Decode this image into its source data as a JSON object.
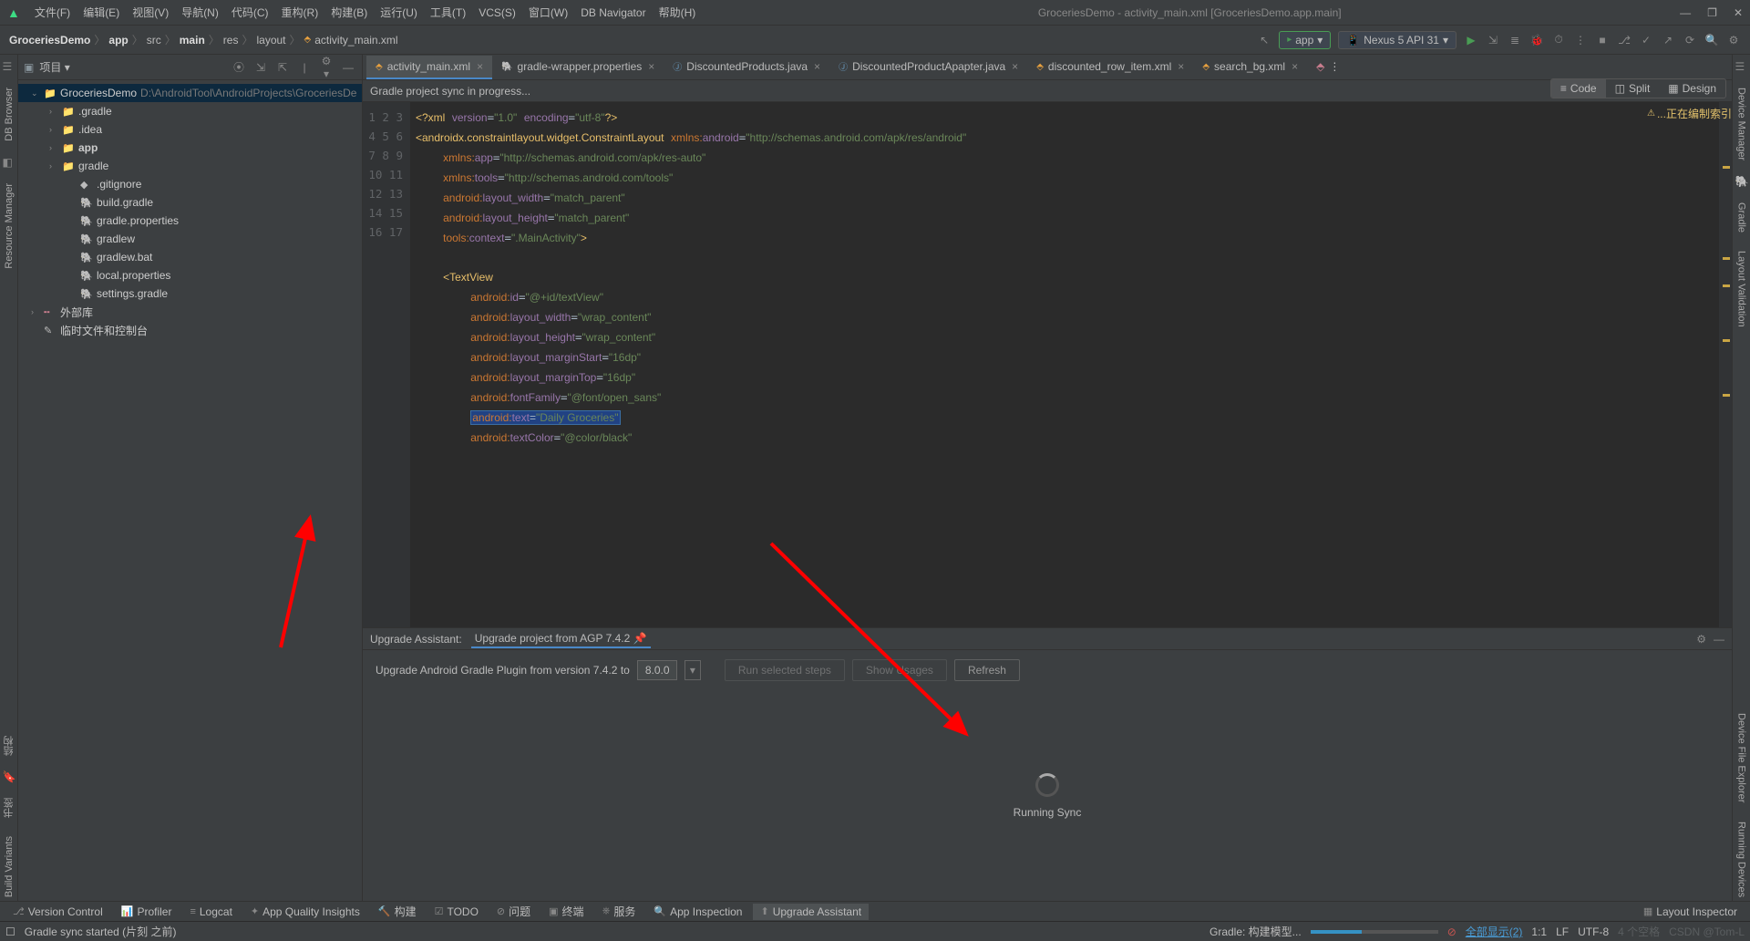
{
  "window_title": "GroceriesDemo - activity_main.xml [GroceriesDemo.app.main]",
  "menu": [
    "文件(F)",
    "编辑(E)",
    "视图(V)",
    "导航(N)",
    "代码(C)",
    "重构(R)",
    "构建(B)",
    "运行(U)",
    "工具(T)",
    "VCS(S)",
    "窗口(W)",
    "DB Navigator",
    "帮助(H)"
  ],
  "breadcrumb": [
    "GroceriesDemo",
    "app",
    "src",
    "main",
    "res",
    "layout",
    "activity_main.xml"
  ],
  "run_config": "app",
  "device": "Nexus 5 API 31",
  "project_tool_label": "项目",
  "tree": [
    {
      "depth": 0,
      "exp": true,
      "icon": "folder",
      "name": "GroceriesDemo",
      "path": "D:\\AndroidTool\\AndroidProjects\\GroceriesDe",
      "sel": true
    },
    {
      "depth": 1,
      "exp": false,
      "icon": "folder",
      "name": ".gradle"
    },
    {
      "depth": 1,
      "exp": false,
      "icon": "folder",
      "name": ".idea"
    },
    {
      "depth": 1,
      "exp": false,
      "icon": "folder",
      "name": "app",
      "bold": true
    },
    {
      "depth": 1,
      "exp": false,
      "icon": "folder",
      "name": "gradle"
    },
    {
      "depth": 2,
      "icon": "git",
      "name": ".gitignore"
    },
    {
      "depth": 2,
      "icon": "gradle",
      "name": "build.gradle"
    },
    {
      "depth": 2,
      "icon": "gradle",
      "name": "gradle.properties"
    },
    {
      "depth": 2,
      "icon": "gradle",
      "name": "gradlew"
    },
    {
      "depth": 2,
      "icon": "gradle",
      "name": "gradlew.bat"
    },
    {
      "depth": 2,
      "icon": "gradle",
      "name": "local.properties"
    },
    {
      "depth": 2,
      "icon": "gradle",
      "name": "settings.gradle"
    },
    {
      "depth": 0,
      "exp": false,
      "icon": "lib",
      "name": "外部库"
    },
    {
      "depth": 0,
      "icon": "scratch",
      "name": "临时文件和控制台"
    }
  ],
  "tabs": [
    {
      "icon": "xml",
      "label": "activity_main.xml",
      "active": true
    },
    {
      "icon": "gradle",
      "label": "gradle-wrapper.properties"
    },
    {
      "icon": "java",
      "label": "DiscountedProducts.java"
    },
    {
      "icon": "java",
      "label": "DiscountedProductApapter.java"
    },
    {
      "icon": "xml",
      "label": "discounted_row_item.xml"
    },
    {
      "icon": "xml",
      "label": "search_bg.xml"
    }
  ],
  "sync_banner": "Gradle project sync in progress...",
  "view_modes": {
    "code": "Code",
    "split": "Split",
    "design": "Design"
  },
  "code_lines": 17,
  "warn_text": "正在编制索引...",
  "upgrade": {
    "header": "Upgrade Assistant:",
    "tab": "Upgrade project from AGP 7.4.2",
    "line": "Upgrade Android Gradle Plugin from version 7.4.2 to",
    "version": "8.0.0",
    "btn_run": "Run selected steps",
    "btn_usages": "Show Usages",
    "btn_refresh": "Refresh",
    "sync": "Running Sync"
  },
  "bottom_tools": [
    "Version Control",
    "Profiler",
    "Logcat",
    "App Quality Insights",
    "构建",
    "TODO",
    "问题",
    "终端",
    "服务",
    "App Inspection",
    "Upgrade Assistant"
  ],
  "bottom_right": "Layout Inspector",
  "status": {
    "left": "Gradle sync started (片刻 之前)",
    "gradle": "Gradle:  构建模型...",
    "show_all": "全部显示(2)",
    "pos": "1:1",
    "eol": "LF",
    "enc": "UTF-8",
    "spaces": "4 个空格",
    "watermark": "CSDN @Tom-L"
  },
  "left_strip": [
    "DB Browser",
    "Resource Manager",
    "结构",
    "书签",
    "Build Variants"
  ],
  "right_strip": [
    "Device Manager",
    "Gradle",
    "Layout Validation",
    "Device File Explorer",
    "Running Devices"
  ]
}
